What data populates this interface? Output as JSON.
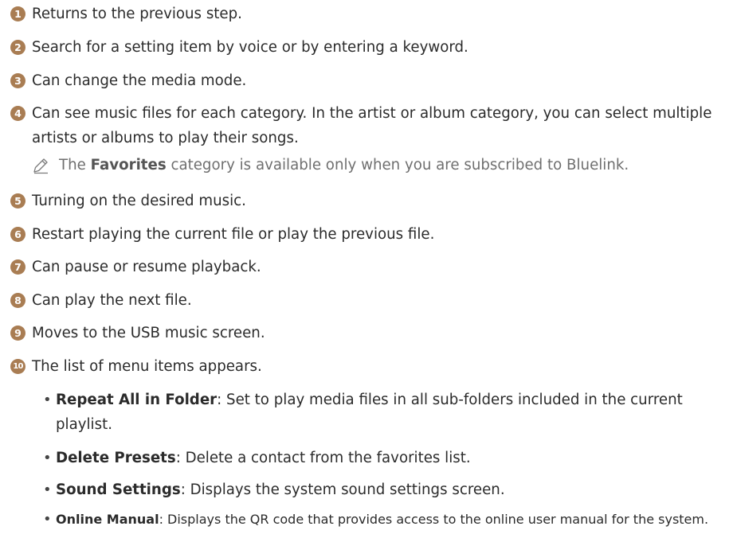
{
  "items": [
    {
      "num": "1",
      "text": "Returns to the previous step."
    },
    {
      "num": "2",
      "text": "Search for a setting item by voice or by entering a keyword."
    },
    {
      "num": "3",
      "text": "Can change the media mode."
    },
    {
      "num": "4",
      "text": "Can see music files for each category. In the artist or album category, you can select multiple artists or albums to play their songs."
    },
    {
      "num": "5",
      "text": "Turning on the desired music."
    },
    {
      "num": "6",
      "text": "Restart playing the current file or play the previous file."
    },
    {
      "num": "7",
      "text": "Can pause or resume playback."
    },
    {
      "num": "8",
      "text": "Can play the next file."
    },
    {
      "num": "9",
      "text": "Moves to the USB music screen."
    },
    {
      "num": "10",
      "text": "The list of menu items appears."
    }
  ],
  "note": {
    "icon": "pencil-icon",
    "prefix": "The",
    "bold": "Favorites",
    "suffix": "category is available only when you are subscribed to Bluelink."
  },
  "menu_items": [
    {
      "term": "Repeat All in Folder",
      "desc": ": Set to play media files in all sub-folders included in the current playlist."
    },
    {
      "term": "Delete Presets",
      "desc": ": Delete a contact from the favorites list."
    },
    {
      "term": "Sound Settings",
      "desc": ": Displays the system sound settings screen."
    },
    {
      "term": "Online Manual",
      "desc": ": Displays the QR code that provides access to the online user manual for the system."
    }
  ],
  "colors": {
    "accent": "#a97d53",
    "text": "#2b2b2b",
    "note_text": "#6f6f6f"
  }
}
